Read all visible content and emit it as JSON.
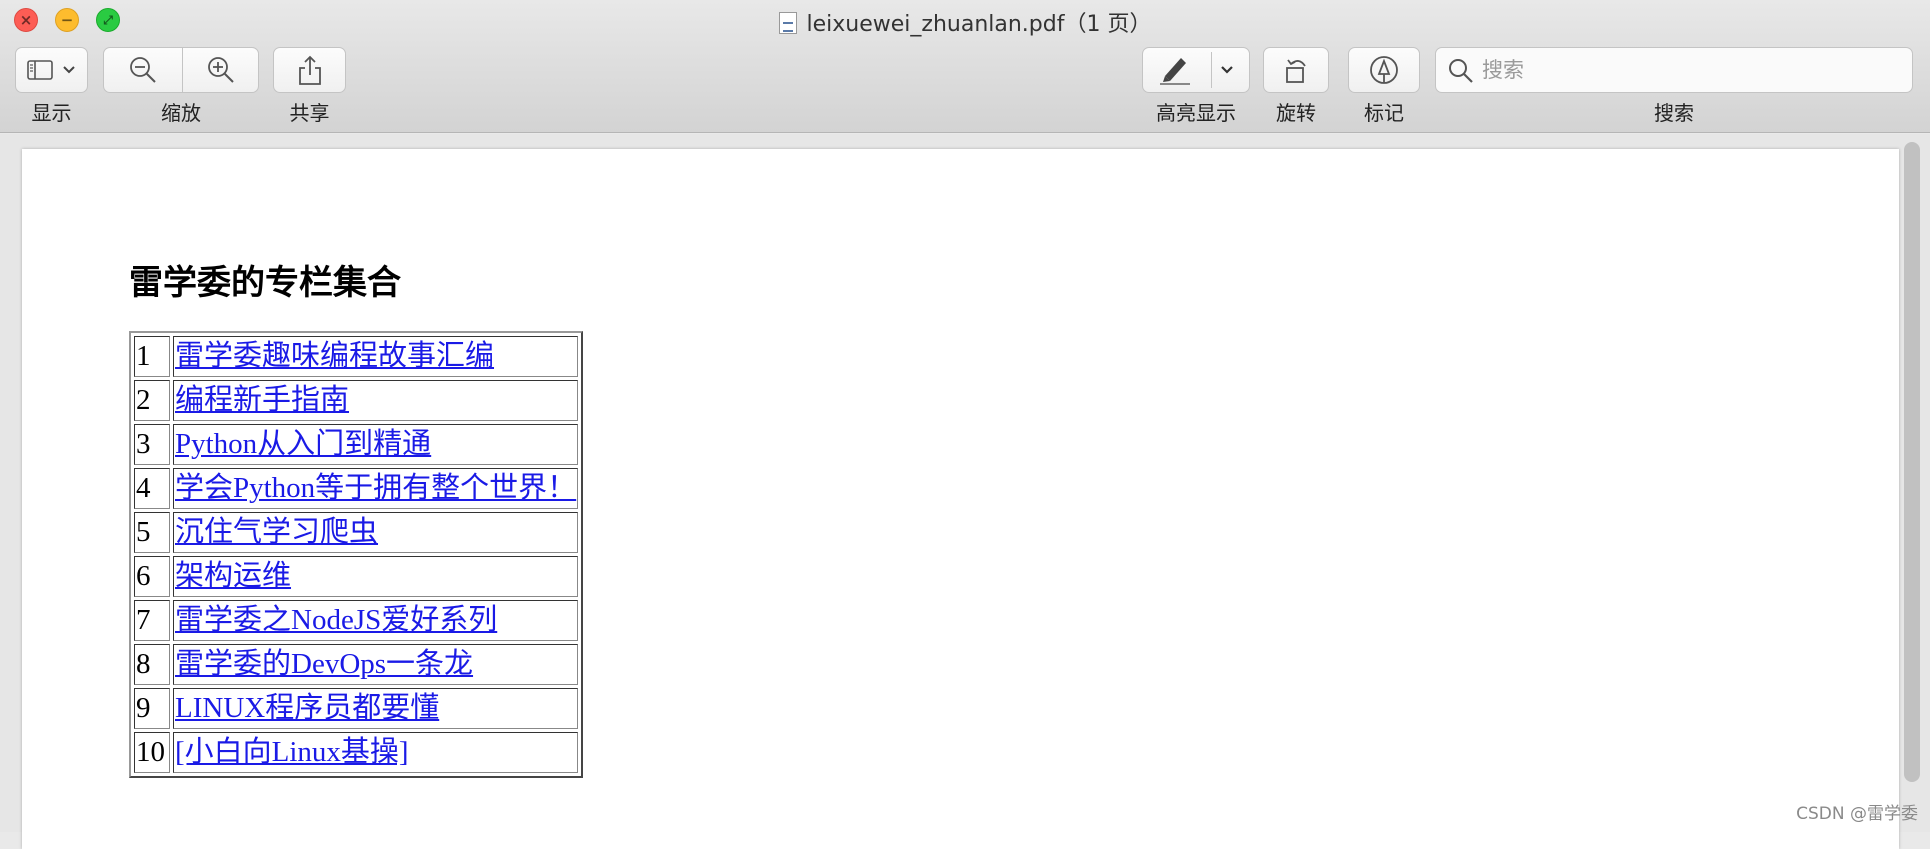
{
  "window": {
    "title": "leixuewei_zhuanlan.pdf",
    "page_count": "（1 页）"
  },
  "toolbar": {
    "view_label": "显示",
    "zoom_label": "缩放",
    "share_label": "共享",
    "highlight_label": "高亮显示",
    "rotate_label": "旋转",
    "markup_label": "标记",
    "search_label": "搜索",
    "search_placeholder": "搜索"
  },
  "document": {
    "heading": "雷学委的专栏集合",
    "rows": [
      {
        "num": "1",
        "title": "雷学委趣味编程故事汇编"
      },
      {
        "num": "2",
        "title": "编程新手指南"
      },
      {
        "num": "3",
        "title": "Python从入门到精通"
      },
      {
        "num": "4",
        "title": "学会Python等于拥有整个世界！"
      },
      {
        "num": "5",
        "title": "沉住气学习爬虫"
      },
      {
        "num": "6",
        "title": "架构运维"
      },
      {
        "num": "7",
        "title": "雷学委之NodeJS爱好系列"
      },
      {
        "num": "8",
        "title": "雷学委的DevOps一条龙"
      },
      {
        "num": "9",
        "title": "LINUX程序员都要懂"
      },
      {
        "num": "10",
        "title": "[小白向Linux基操]"
      }
    ]
  },
  "watermark": "CSDN @雷学委",
  "colors": {
    "link": "#1a1ae6",
    "close": "#fd5d55",
    "minimize": "#fdbc2e",
    "maximize": "#2acb42"
  }
}
